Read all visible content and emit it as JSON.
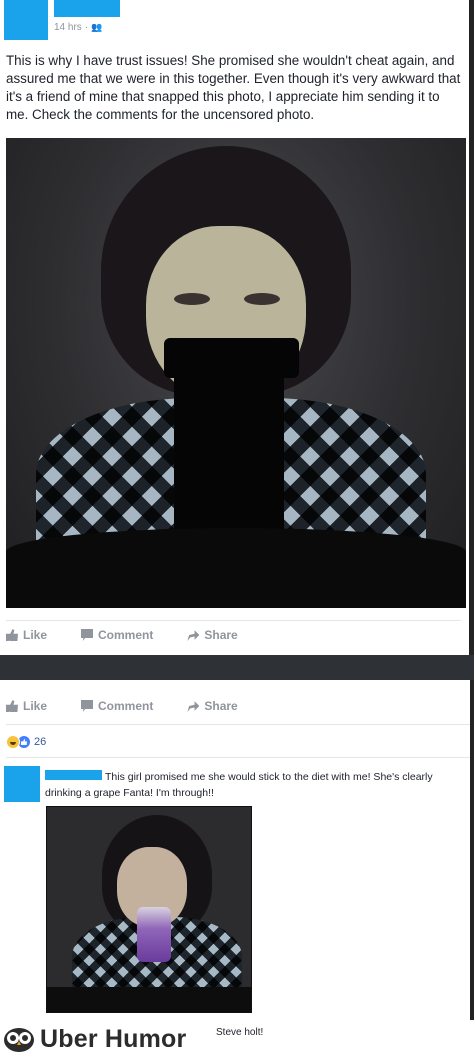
{
  "post": {
    "timestamp": "14 hrs",
    "audience_separator": "·",
    "audience_icon": "friends-icon",
    "text": "This is why I have trust issues! She promised she wouldn't cheat again, and assured me that we were in this together. Even though it's very awkward that it's a friend of mine that snapped this photo, I appreciate him sending it to me. Check the comments for the uncensored photo.",
    "photo": "censored-photo"
  },
  "actions_top": {
    "like": "Like",
    "comment": "Comment",
    "share": "Share"
  },
  "actions_bottom": {
    "like": "Like",
    "comment": "Comment",
    "share": "Share"
  },
  "reactions": {
    "icons": [
      "haha-icon",
      "like-icon"
    ],
    "count": "26"
  },
  "comment": {
    "text": "This girl promised me she would stick to the diet with me! She's clearly drinking a grape Fanta! I'm through!!",
    "photo": "uncensored-photo"
  },
  "footer": {
    "brand": "Uber Humor",
    "caption": "Steve holt!"
  },
  "colors": {
    "redaction_blue": "#1aa3ea",
    "fb_gray": "#90949c",
    "link_blue": "#365899"
  }
}
